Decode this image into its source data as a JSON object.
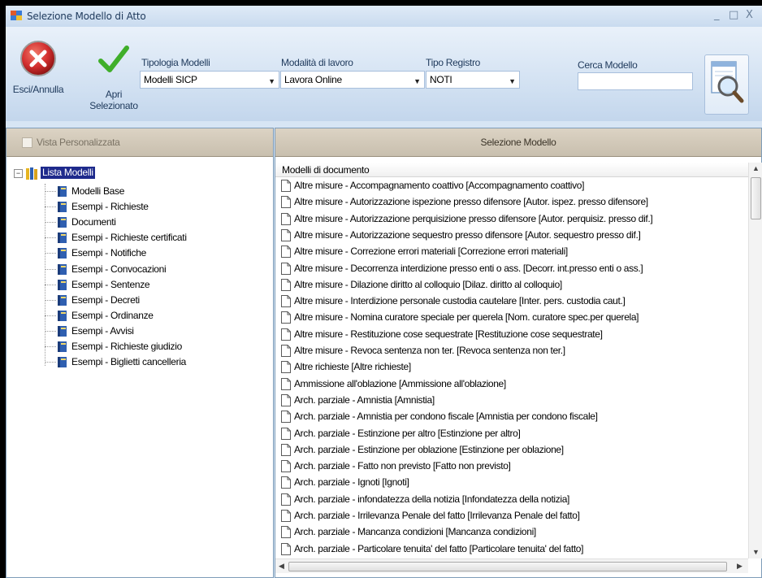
{
  "window": {
    "title": "Selezione Modello di Atto",
    "controls": {
      "minimize": "_",
      "maximize": "□",
      "close": "X"
    }
  },
  "toolbar": {
    "cancel_label": "Esci/Annulla",
    "open_label_line1": "Apri",
    "open_label_line2": "Selezionato",
    "tipologia": {
      "label": "Tipologia Modelli",
      "value": "Modelli SICP"
    },
    "modalita": {
      "label": "Modalità di lavoro",
      "value": "Lavora Online"
    },
    "registro": {
      "label": "Tipo Registro",
      "value": "NOTI"
    },
    "search": {
      "label": "Cerca Modello",
      "value": ""
    }
  },
  "left_panel": {
    "checkbox_label": "Vista Personalizzata",
    "expander": "−",
    "tree_root": "Lista Modelli",
    "tree_items": [
      "Modelli Base",
      "Esempi - Richieste",
      "Documenti",
      "Esempi - Richieste certificati",
      "Esempi - Notifiche",
      "Esempi - Convocazioni",
      "Esempi - Sentenze",
      "Esempi - Decreti",
      "Esempi - Ordinanze",
      "Esempi - Avvisi",
      "Esempi - Richieste giudizio",
      "Esempi - Biglietti cancelleria"
    ]
  },
  "right_panel": {
    "header": "Selezione Modello",
    "column_header": "Modelli di documento",
    "items": [
      "Altre misure - Accompagnamento coattivo [Accompagnamento coattivo]",
      "Altre misure - Autorizzazione ispezione presso difensore [Autor. ispez. presso difensore]",
      "Altre misure - Autorizzazione perquisizione presso difensore [Autor. perquisiz. presso dif.]",
      "Altre misure - Autorizzazione sequestro presso difensore [Autor. sequestro presso dif.]",
      "Altre misure - Correzione errori materiali [Correzione errori materiali]",
      "Altre misure - Decorrenza interdizione presso enti o ass. [Decorr. int.presso enti o ass.]",
      "Altre misure - Dilazione diritto al colloquio [Dilaz. diritto al colloquio]",
      "Altre misure - Interdizione personale custodia cautelare [Inter. pers. custodia caut.]",
      "Altre misure - Nomina curatore speciale per querela [Nom. curatore spec.per querela]",
      "Altre misure - Restituzione cose sequestrate [Restituzione cose sequestrate]",
      "Altre misure - Revoca sentenza non ter. [Revoca sentenza non ter.]",
      "Altre richieste [Altre richieste]",
      "Ammissione all'oblazione [Ammissione all'oblazione]",
      "Arch. parziale - Amnistia [Amnistia]",
      "Arch. parziale - Amnistia per condono fiscale [Amnistia per condono fiscale]",
      "Arch. parziale - Estinzione per altro [Estinzione per altro]",
      "Arch. parziale - Estinzione per oblazione [Estinzione per oblazione]",
      "Arch. parziale - Fatto non previsto [Fatto non previsto]",
      "Arch. parziale - Ignoti [Ignoti]",
      "Arch. parziale - infondatezza della notizia [Infondatezza della notizia]",
      "Arch. parziale - Irrilevanza Penale del fatto [Irrilevanza Penale del fatto]",
      "Arch. parziale - Mancanza condizioni [Mancanza condizioni]",
      "Arch. parziale - Particolare tenuita' del fatto [Particolare tenuita' del fatto]"
    ],
    "scroll": {
      "up": "▲",
      "down": "▼",
      "left": "◀",
      "right": "▶"
    }
  },
  "colors": {
    "ribbon": "#d7e5f4",
    "panel_header": "#d1c8b8",
    "tree_selected": "#1e2a8c",
    "cancel_red": "#d32f2f",
    "check_green": "#3fae2a"
  }
}
